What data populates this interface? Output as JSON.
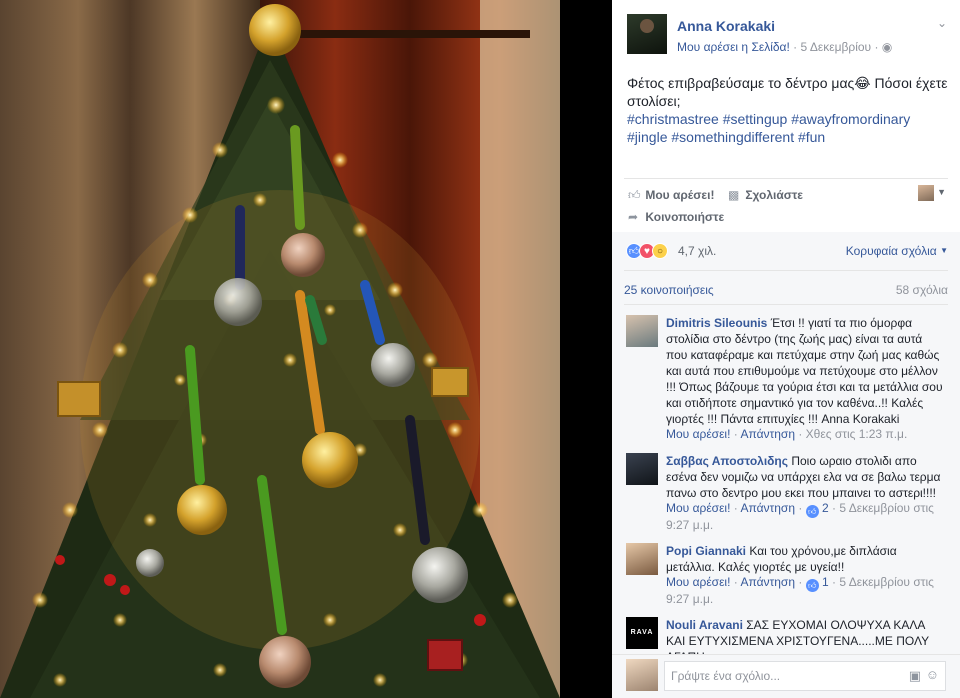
{
  "post": {
    "author": "Anna Korakaki",
    "like_page": "Μου αρέσει η Σελίδα!",
    "separator": "·",
    "date": "5 Δεκεμβρίου",
    "text": "Φέτος επιβραβεύσαμε το δέντρο μας😂 Πόσοι έχετε στολίσει;",
    "hashtags": "#christmastree #settingup #awayfromordinary #jingle #somethingdifferent #fun"
  },
  "actions": {
    "like": "Μου αρέσει!",
    "comment": "Σχολιάστε",
    "share": "Κοινοποιήστε"
  },
  "reactions": {
    "count": "4,7 χιλ.",
    "top_comments": "Κορυφαία σχόλια"
  },
  "stats": {
    "shares": "25 κοινοποιήσεις",
    "comments": "58 σχόλια"
  },
  "comments": [
    {
      "name": "Dimitris Sileounis",
      "text": "Έτσι !! γιατί τα πιο όμορφα στολίδια στο δέντρο (της ζωής μας) είναι τα αυτά που καταφέραμε και πετύχαμε στην ζωή μας καθώς και αυτά που επιθυμούμε να πετύχουμε στο μέλλον !!! Όπως βάζουμε τα γούρια έτσι και τα μετάλλια σου και οτιδήποτε σημαντικό για τον καθένα..!! Καλές γιορτές !!! Πάντα επιτυχίες !!! Anna Korakaki",
      "like": "Μου αρέσει!",
      "reply": "Απάντηση",
      "likes": "",
      "time": "Χθες στις 1:23 π.μ."
    },
    {
      "name": "Σαββας Αποστολιδης",
      "text": "Ποιο ωραιο στολιδι απο εσένα δεν νομιζω να υπάρχει ελα να σε βαλω τερμα πανω στο δεντρο μου εκει που μπαινει το αστερι!!!!",
      "like": "Μου αρέσει!",
      "reply": "Απάντηση",
      "likes": "2",
      "time": "5 Δεκεμβρίου στις 9:27 μ.μ."
    },
    {
      "name": "Popi Giannaki",
      "text": "Και του χρόνου,με διπλάσια μετάλλια. Καλές γιορτές με υγεία!!",
      "like": "Μου αρέσει!",
      "reply": "Απάντηση",
      "likes": "1",
      "time": "5 Δεκεμβρίου στις 9:27 μ.μ."
    },
    {
      "name": "Nouli Aravani",
      "text": "ΣΑΣ ΕΥΧΟΜΑΙ ΟΛΟΨΥΧΑ ΚΑΛΑ ΚΑΙ ΕΥΤΥΧΙΣΜΕΝΑ ΧΡΙΣΤΟΥΓΕΝΑ.....ΜΕ ΠΟΛΥ ΑΓΑΠΗ",
      "avatar_text": "RAVA",
      "like": "",
      "reply": "",
      "likes": "",
      "time": ""
    }
  ],
  "composer": {
    "placeholder": "Γράψτε ένα σχόλιο..."
  },
  "icons": {
    "chevron": "chevron-down-icon",
    "globe": "globe-icon",
    "like": "thumbs-up-icon",
    "comment": "speech-bubble-icon",
    "share": "share-arrow-icon",
    "camera": "camera-icon",
    "emoji": "smiley-icon"
  },
  "colors": {
    "link": "#365899",
    "meta": "#90949c",
    "like_blue": "#5890ff",
    "love_red": "#f25268",
    "wow_yellow": "#fcd14b"
  }
}
